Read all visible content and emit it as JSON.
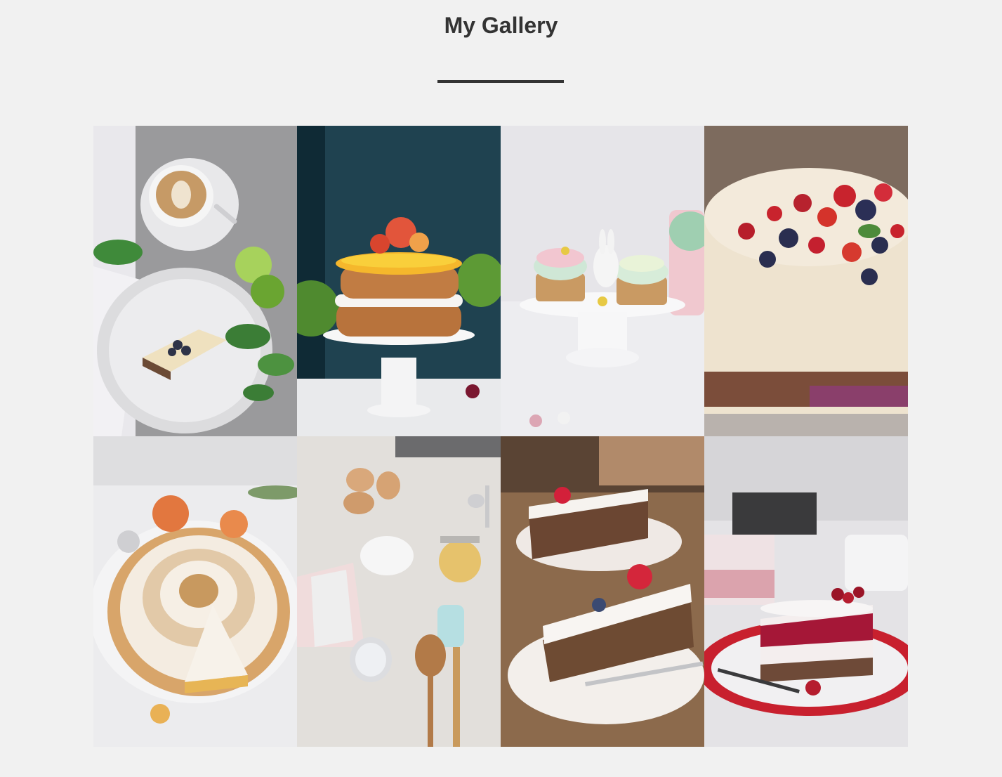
{
  "page": {
    "title": "My Gallery"
  },
  "colors": {
    "background": "#f1f1f1",
    "title": "#333333",
    "underline": "#333333"
  },
  "gallery": {
    "items": [
      {
        "name": "tiramisu-coffee-photo"
      },
      {
        "name": "layer-cake-orange-photo"
      },
      {
        "name": "easter-cupcakes-photo"
      },
      {
        "name": "berry-cheesecake-photo"
      },
      {
        "name": "meringue-tart-photo"
      },
      {
        "name": "baking-ingredients-photo"
      },
      {
        "name": "carrot-cake-slices-photo"
      },
      {
        "name": "red-velvet-cake-slice-photo"
      }
    ]
  }
}
